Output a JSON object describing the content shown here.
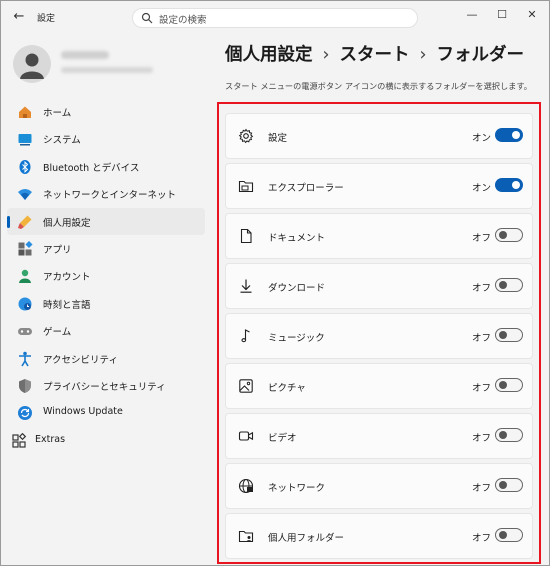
{
  "window": {
    "title": "設定",
    "controls": [
      "minimize-icon",
      "maximize-icon",
      "close-icon"
    ]
  },
  "search": {
    "placeholder": "設定の検索"
  },
  "sidebar": {
    "items": [
      {
        "label": "ホーム",
        "icon": "home-icon"
      },
      {
        "label": "システム",
        "icon": "system-icon"
      },
      {
        "label": "Bluetooth とデバイス",
        "icon": "bluetooth-icon"
      },
      {
        "label": "ネットワークとインターネット",
        "icon": "wifi-icon"
      },
      {
        "label": "個人用設定",
        "icon": "personalization-icon",
        "selected": true
      },
      {
        "label": "アプリ",
        "icon": "apps-icon"
      },
      {
        "label": "アカウント",
        "icon": "account-icon"
      },
      {
        "label": "時刻と言語",
        "icon": "time-language-icon"
      },
      {
        "label": "ゲーム",
        "icon": "gaming-icon"
      },
      {
        "label": "アクセシビリティ",
        "icon": "accessibility-icon"
      },
      {
        "label": "プライバシーとセキュリティ",
        "icon": "shield-icon"
      },
      {
        "label": "Windows Update",
        "icon": "windows-update-icon"
      }
    ],
    "extra": {
      "label": "Extras",
      "icon": "extras-icon"
    }
  },
  "breadcrumb": [
    "個人用設定",
    "スタート",
    "フォルダー"
  ],
  "description": "スタート メニューの電源ボタン アイコンの横に表示するフォルダーを選択します。",
  "folders": [
    {
      "label": "設定",
      "state": "オン",
      "on": true,
      "icon": "gear-icon"
    },
    {
      "label": "エクスプローラー",
      "state": "オン",
      "on": true,
      "icon": "file-explorer-icon"
    },
    {
      "label": "ドキュメント",
      "state": "オフ",
      "on": false,
      "icon": "document-icon"
    },
    {
      "label": "ダウンロード",
      "state": "オフ",
      "on": false,
      "icon": "download-icon"
    },
    {
      "label": "ミュージック",
      "state": "オフ",
      "on": false,
      "icon": "music-icon"
    },
    {
      "label": "ピクチャ",
      "state": "オフ",
      "on": false,
      "icon": "picture-icon"
    },
    {
      "label": "ビデオ",
      "state": "オフ",
      "on": false,
      "icon": "video-icon"
    },
    {
      "label": "ネットワーク",
      "state": "オフ",
      "on": false,
      "icon": "network-icon"
    },
    {
      "label": "個人用フォルダー",
      "state": "オフ",
      "on": false,
      "icon": "personal-folder-icon"
    }
  ],
  "colors": {
    "accent": "#005fb8",
    "highlight_box": "#e8141f"
  }
}
